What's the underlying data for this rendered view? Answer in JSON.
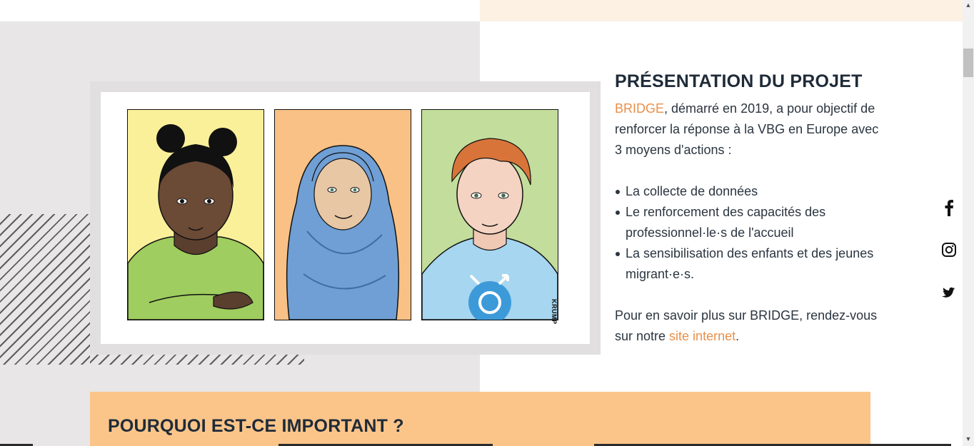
{
  "presentation": {
    "heading": "PRÉSENTATION DU PROJET",
    "intro_link": "BRIDGE",
    "intro_text": ", démarré en 2019, a pour objectif de renforcer la réponse à la VBG en Europe avec 3 moyens d'actions :",
    "list_items": [
      "La collecte de données",
      "Le renforcement des capacités des professionnel·le·s de l'accueil",
      "La sensibilisation des enfants et des jeunes migrant·e·s."
    ],
    "outro_text": "Pour en savoir plus sur BRIDGE, rendez-vous sur notre ",
    "outro_link": "site internet",
    "outro_end": "."
  },
  "illustration": {
    "signature": "KRUMP",
    "panel_colors": [
      "#fbf09a",
      "#f9c185",
      "#c3dd9c"
    ]
  },
  "social": {
    "icons": [
      "facebook-icon",
      "instagram-icon",
      "twitter-icon"
    ]
  },
  "section2": {
    "title": "POURQUOI EST-CE IMPORTANT ?"
  },
  "colors": {
    "accent": "#e8904a",
    "band": "#fbc58a",
    "panel_grey": "#e8e6e6",
    "cream": "#fcf1e3"
  }
}
